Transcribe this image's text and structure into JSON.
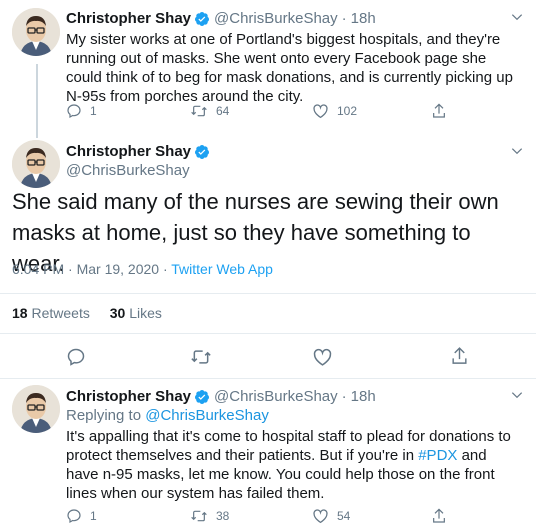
{
  "colors": {
    "accent": "#1da1f2",
    "muted": "#657786",
    "text": "#14171a"
  },
  "tweet1": {
    "name": "Christopher Shay",
    "handle": "@ChrisBurkeShay",
    "dot": "·",
    "time": "18h",
    "text": "My sister works at one of Portland's biggest hospitals, and they're running out of masks. She went onto every Facebook page she could think of to beg for mask donations, and is currently picking up N-95s from porches around the city.",
    "replies": "1",
    "retweets": "64",
    "likes": "102"
  },
  "tweet2": {
    "name": "Christopher Shay",
    "handle": "@ChrisBurkeShay",
    "text": "She said many of the nurses are sewing their own masks at home, just so they have something to wear.",
    "timestamp": "6:04 PM · Mar 19, 2020 · ",
    "app": "Twitter Web App",
    "retweets_count": "18",
    "retweets_label": "Retweets",
    "likes_count": "30",
    "likes_label": "Likes"
  },
  "tweet3": {
    "name": "Christopher Shay",
    "handle": "@ChrisBurkeShay",
    "dot": "·",
    "time": "18h",
    "replying_prefix": "Replying to ",
    "replying_handle": "@ChrisBurkeShay",
    "text_a": "It's appalling that it's come to hospital staff to plead for donations to protect themselves and their patients. But if you're in ",
    "hashtag": "#PDX",
    "text_b": " and have n-95 masks, let me know. You could help those on the front lines when our system has failed them.",
    "replies": "1",
    "retweets": "38",
    "likes": "54"
  },
  "icons": [
    "reply-icon",
    "retweet-icon",
    "like-icon",
    "share-icon",
    "verified-icon",
    "chevron-down-icon"
  ]
}
